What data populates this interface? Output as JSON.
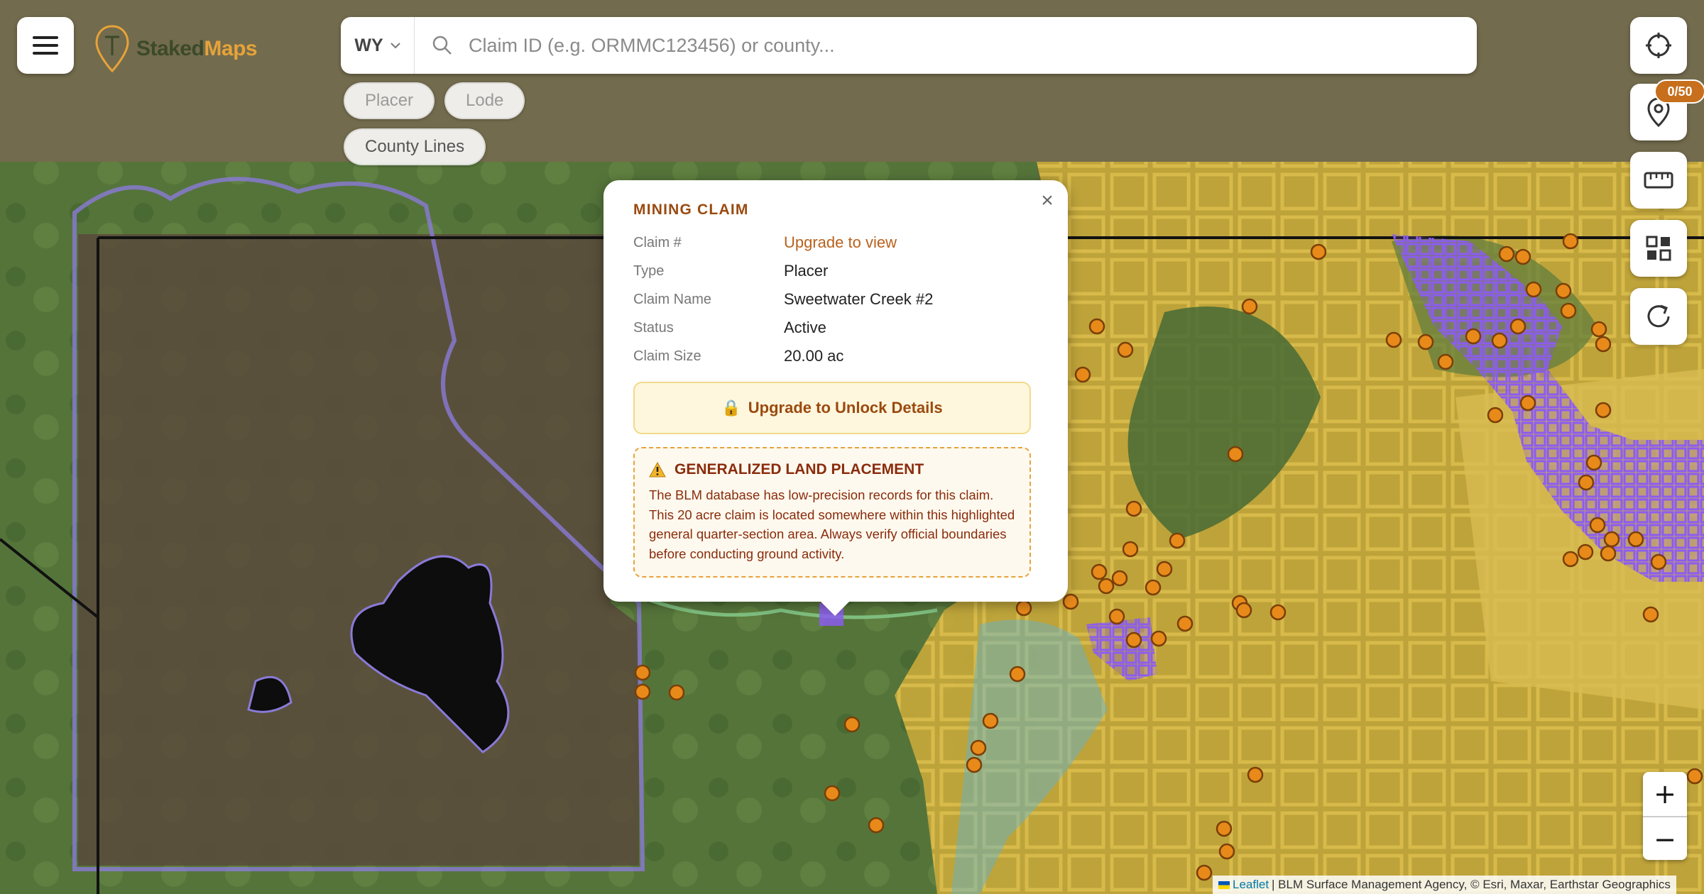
{
  "header": {
    "logo_text_part1": "Staked",
    "logo_text_part2": "Maps",
    "state": "WY",
    "search_placeholder": "Claim ID (e.g. ORMMC123456) or county..."
  },
  "filters": {
    "chips": [
      "Placer",
      "Lode",
      "County Lines"
    ]
  },
  "side_controls": {
    "claims_counter": "0/50"
  },
  "popup": {
    "title": "MINING CLAIM",
    "fields": [
      {
        "label": "Claim #",
        "value": "Upgrade to view"
      },
      {
        "label": "Type",
        "value": "Placer"
      },
      {
        "label": "Claim Name",
        "value": "Sweetwater Creek #2"
      },
      {
        "label": "Status",
        "value": "Active"
      },
      {
        "label": "Claim Size",
        "value": "20.00 ac"
      }
    ],
    "upgrade_button": "Upgrade to Unlock Details",
    "notice_title": "GENERALIZED LAND PLACEMENT",
    "notice_body": "The BLM database has low-precision records for this claim. This 20 acre claim is located somewhere within this highlighted general quarter-section area. Always verify official boundaries before conducting ground activity."
  },
  "zoom": {
    "in": "+",
    "out": "−"
  },
  "attribution": {
    "leaflet": "Leaflet",
    "text": "| BLM Surface Management Agency, © Esri, Maxar, Earthstar Geographics"
  },
  "colors": {
    "accent": "#e6a33a",
    "popup_title": "#9a4a10",
    "claim_marker": "#e88a1a",
    "lode_claim": "#8c5cf0",
    "blm_land": "#d4b23c",
    "forest_land": "#7fbf7f",
    "park_boundary": "#8a7ad8",
    "water": "#5ab4d8"
  }
}
